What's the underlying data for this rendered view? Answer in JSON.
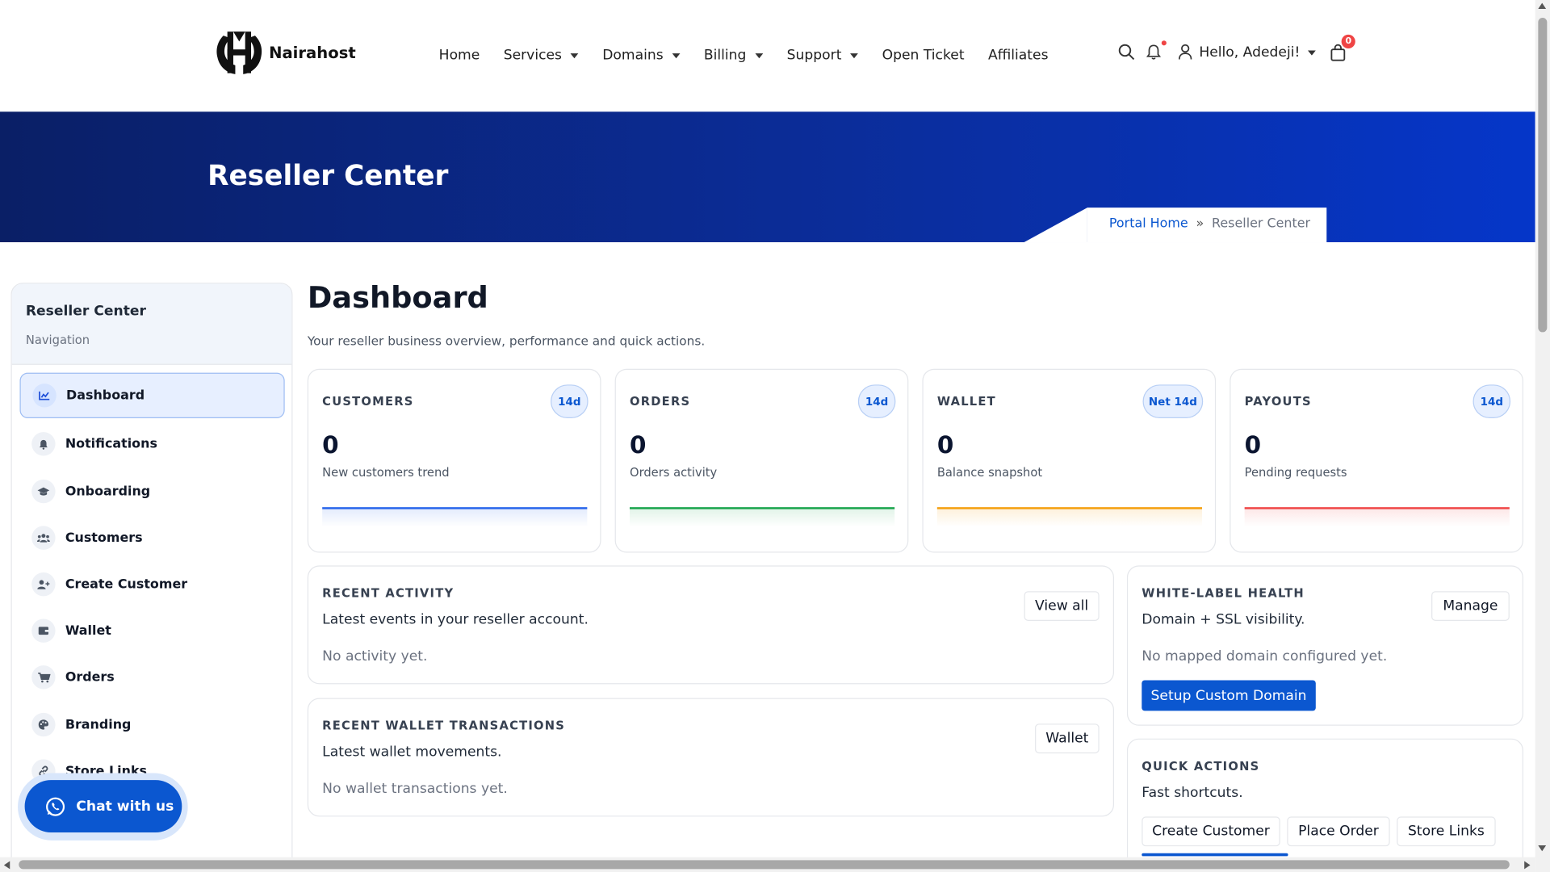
{
  "brand": {
    "name": "Nairahost"
  },
  "nav": {
    "items": [
      {
        "label": "Home",
        "dropdown": false
      },
      {
        "label": "Services",
        "dropdown": true
      },
      {
        "label": "Domains",
        "dropdown": true
      },
      {
        "label": "Billing",
        "dropdown": true
      },
      {
        "label": "Support",
        "dropdown": true
      },
      {
        "label": "Open Ticket",
        "dropdown": false
      },
      {
        "label": "Affiliates",
        "dropdown": false
      }
    ],
    "greeting": "Hello, Adedeji!",
    "cart_count": "0"
  },
  "hero": {
    "title": "Reseller Center",
    "breadcrumb": {
      "home": "Portal Home",
      "sep": "»",
      "current": "Reseller Center"
    }
  },
  "sidebar": {
    "title": "Reseller Center",
    "subtitle": "Navigation",
    "items": [
      {
        "label": "Dashboard",
        "icon": "chart-line-icon",
        "active": true
      },
      {
        "label": "Notifications",
        "icon": "bell-icon",
        "active": false
      },
      {
        "label": "Onboarding",
        "icon": "graduation-cap-icon",
        "active": false
      },
      {
        "label": "Customers",
        "icon": "users-icon",
        "active": false
      },
      {
        "label": "Create Customer",
        "icon": "user-plus-icon",
        "active": false
      },
      {
        "label": "Wallet",
        "icon": "wallet-icon",
        "active": false
      },
      {
        "label": "Orders",
        "icon": "cart-icon",
        "active": false
      },
      {
        "label": "Branding",
        "icon": "palette-icon",
        "active": false
      },
      {
        "label": "Store Links",
        "icon": "link-icon",
        "active": false
      }
    ]
  },
  "chat": {
    "label": "Chat with us"
  },
  "main": {
    "title": "Dashboard",
    "subtitle": "Your reseller business overview, performance and quick actions.",
    "stats": [
      {
        "label": "CUSTOMERS",
        "badge": "14d",
        "value": "0",
        "caption": "New customers trend",
        "color": "#2563eb"
      },
      {
        "label": "ORDERS",
        "badge": "14d",
        "value": "0",
        "caption": "Orders activity",
        "color": "#16a34a"
      },
      {
        "label": "WALLET",
        "badge": "Net 14d",
        "value": "0",
        "caption": "Balance snapshot",
        "color": "#f59e0b"
      },
      {
        "label": "PAYOUTS",
        "badge": "14d",
        "value": "0",
        "caption": "Pending requests",
        "color": "#ef4444"
      }
    ],
    "recent_activity": {
      "heading": "RECENT ACTIVITY",
      "sub": "Latest events in your reseller account.",
      "empty": "No activity yet.",
      "button": "View all"
    },
    "wallet_tx": {
      "heading": "RECENT WALLET TRANSACTIONS",
      "sub": "Latest wallet movements.",
      "empty": "No wallet transactions yet.",
      "button": "Wallet"
    },
    "white_label": {
      "heading": "WHITE-LABEL HEALTH",
      "sub": "Domain + SSL visibility.",
      "empty": "No mapped domain configured yet.",
      "button": "Manage",
      "cta": "Setup Custom Domain"
    },
    "quick_actions": {
      "heading": "QUICK ACTIONS",
      "sub": "Fast shortcuts.",
      "buttons": [
        "Create Customer",
        "Place Order",
        "Store Links"
      ]
    }
  }
}
